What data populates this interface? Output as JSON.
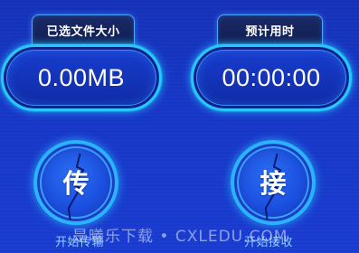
{
  "selected_size": {
    "label": "已选文件大小",
    "value": "0.00MB"
  },
  "estimated_time": {
    "label": "预计用时",
    "value": "00:00:00"
  },
  "send_button": {
    "glyph": "传",
    "caption": "开始传输"
  },
  "receive_button": {
    "glyph": "接",
    "caption": "开始接收"
  },
  "watermark": "是曦乐下载 • CXLEDU.COM",
  "colors": {
    "background": "#1737c6",
    "accent_glow": "#27c8ff",
    "caption": "#8fd0ff"
  }
}
